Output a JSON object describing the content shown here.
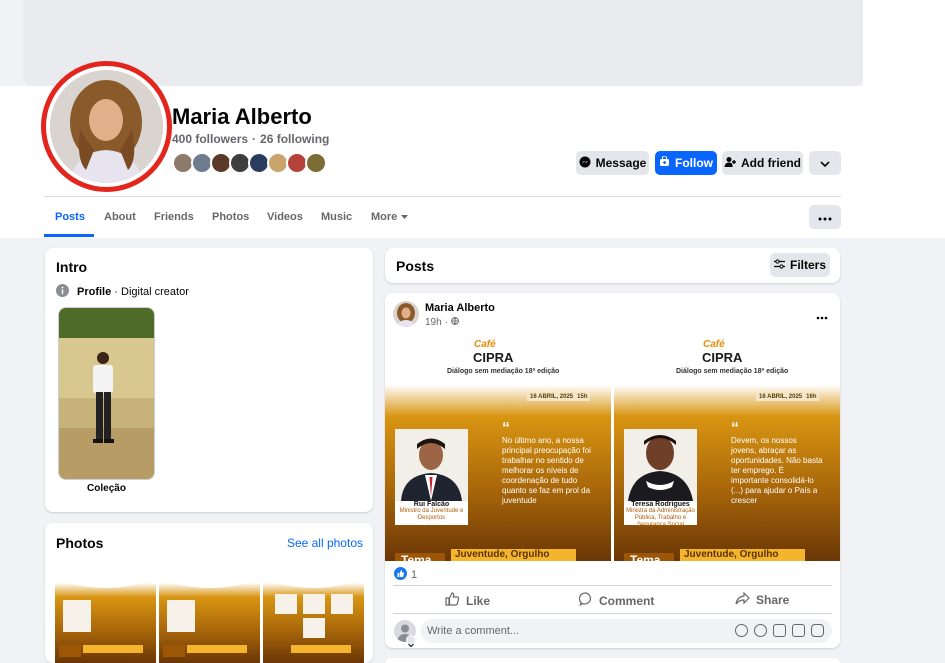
{
  "profile": {
    "name": "Maria Alberto",
    "followers": "400 followers",
    "separator": "·",
    "following": "26 following"
  },
  "actions": {
    "message": "Message",
    "follow": "Follow",
    "add_friend": "Add friend"
  },
  "tabs": [
    "Posts",
    "About",
    "Friends",
    "Photos",
    "Videos",
    "Music",
    "More"
  ],
  "intro": {
    "title": "Intro",
    "profile_label": "Profile",
    "profile_sep": " · ",
    "profile_type": "Digital creator",
    "featured_caption": "Coleção"
  },
  "photos": {
    "title": "Photos",
    "see_all": "See all photos"
  },
  "posts": {
    "title": "Posts",
    "filters": "Filters"
  },
  "post": {
    "author": "Maria Alberto",
    "time": "19h",
    "reactions_count": "1",
    "like": "Like",
    "comment": "Comment",
    "share": "Share",
    "comment_placeholder": "Write a comment...",
    "flyers": [
      {
        "cafe": "Café",
        "brand": "CIPRA",
        "subtitle": "Diálogo sem mediação   18ª edição",
        "date": "16 ABRIL, 2025",
        "time": "15h",
        "quote": "No último ano, a nossa principal preocupação foi trabalhar no sentido de melhorar os níveis de coordenação de tudo quanto se faz em prol da juventude",
        "person": "Rui Falcão",
        "role": "Ministro da Juventude e Desportos",
        "tema": "Tema",
        "bar": "Juventude, Orgulho"
      },
      {
        "cafe": "Café",
        "brand": "CIPRA",
        "subtitle": "Diálogo sem mediação   18ª edição",
        "date": "16 ABRIL, 2025",
        "time": "16h",
        "quote": "Devem, os nossos jovens, abraçar as oportunidades. Não basta ter emprego. É importante consolidá-lo (...) para ajudar o País a crescer",
        "person": "Teresa Rodrigues",
        "role": "Ministra da Administração Pública, Trabalho e Segurança Social",
        "tema": "Tema",
        "bar": "Juventude, Orgulho"
      }
    ]
  },
  "colors": {
    "accent": "#0866ff",
    "avatar_ring": "#e3261d",
    "flyer_orange": "#d89512"
  }
}
